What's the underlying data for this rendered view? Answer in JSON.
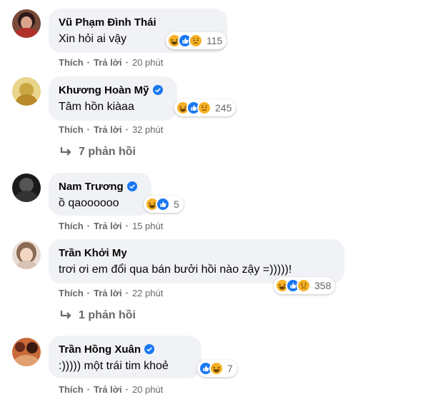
{
  "comments": [
    {
      "name": "Vũ Phạm Đình Thái",
      "verified": false,
      "text": "Xin hỏi ai vậy",
      "reactions": [
        "haha",
        "like",
        "sad"
      ],
      "reaction_count": "115",
      "like_label": "Thích",
      "reply_label": "Trả lời",
      "time": "20 phút"
    },
    {
      "name": "Khương Hoàn Mỹ",
      "verified": true,
      "text": "Tâm hồn kiàaa",
      "reactions": [
        "haha",
        "like",
        "sad"
      ],
      "reaction_count": "245",
      "like_label": "Thích",
      "reply_label": "Trả lời",
      "time": "32 phút",
      "replies": "7 phản hồi"
    },
    {
      "name": "Nam Trương",
      "verified": true,
      "text": "ồ qaoooooo",
      "reactions": [
        "haha",
        "like"
      ],
      "reaction_count": "5",
      "like_label": "Thích",
      "reply_label": "Trả lời",
      "time": "15 phút"
    },
    {
      "name": "Trần Khởi My",
      "verified": false,
      "text": "trơi ơi em đổi qua bán bưởi hồi nào zậy =)))))!",
      "reactions": [
        "haha",
        "like",
        "sad"
      ],
      "reaction_count": "358",
      "like_label": "Thích",
      "reply_label": "Trả lời",
      "time": "22 phút",
      "replies": "1 phản hồi"
    },
    {
      "name": "Trần Hồng Xuân",
      "verified": true,
      "text": ":))))) một trái tim khoẻ",
      "reactions": [
        "like",
        "haha"
      ],
      "reaction_count": "7",
      "like_label": "Thích",
      "reply_label": "Trả lời",
      "time": "20 phút"
    }
  ],
  "colors": {
    "like": "#1877f2",
    "haha": "#f7b125",
    "sad": "#f7b125",
    "verified": "#1877f2",
    "bubble": "#f0f2f5",
    "meta": "#65676b"
  }
}
